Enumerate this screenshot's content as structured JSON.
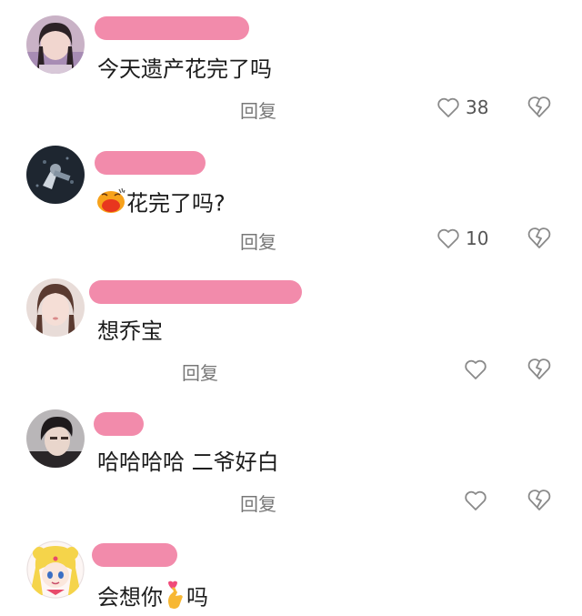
{
  "comments": [
    {
      "text": "今天遗产花完了吗",
      "reply_label": "回复",
      "like_count": "38",
      "avatar_icon": "avatar-girl-photo",
      "heart_icon": "heart-outline-icon",
      "dislike_icon": "broken-heart-icon"
    },
    {
      "emoji": "pouting-face-emoji",
      "text": "花完了吗?",
      "reply_label": "回复",
      "like_count": "10",
      "avatar_icon": "avatar-dark-photo",
      "heart_icon": "heart-outline-icon",
      "dislike_icon": "broken-heart-icon"
    },
    {
      "text": "想乔宝",
      "reply_label": "回复",
      "like_count": "",
      "avatar_icon": "avatar-girl-photo",
      "heart_icon": "heart-outline-icon",
      "dislike_icon": "broken-heart-icon"
    },
    {
      "text": "哈哈哈哈 二爷好白",
      "reply_label": "回复",
      "like_count": "",
      "avatar_icon": "avatar-boy-photo",
      "heart_icon": "heart-outline-icon",
      "dislike_icon": "broken-heart-icon"
    },
    {
      "text_before": "会想你",
      "emoji": "finger-heart-emoji",
      "text_after": "吗",
      "avatar_icon": "avatar-cartoon-sailor-moon"
    }
  ],
  "colors": {
    "name_redaction": "#f28bab",
    "icon_gray": "#8a8a8a"
  }
}
